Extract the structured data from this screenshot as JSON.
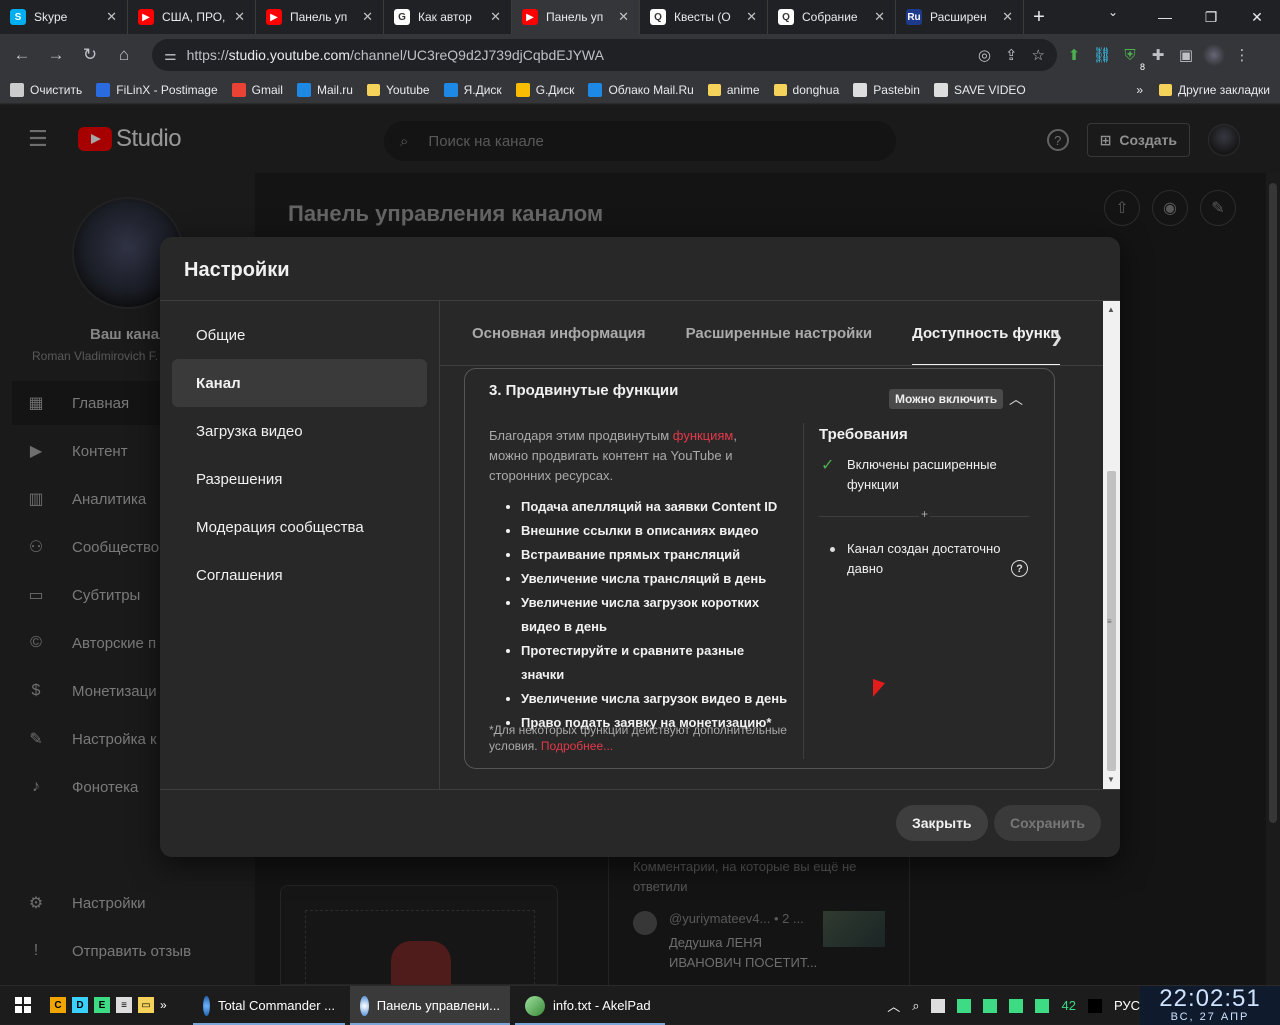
{
  "browser": {
    "tabs": [
      {
        "title": "Skype",
        "icon": "skype-icon",
        "color": "#00aff0",
        "glyph": "S",
        "active": false
      },
      {
        "title": "США, ПРО,",
        "icon": "youtube-icon",
        "color": "#ff0000",
        "glyph": "▶",
        "active": false
      },
      {
        "title": "Панель уп",
        "icon": "youtube-icon",
        "color": "#ff0000",
        "glyph": "▶",
        "active": false
      },
      {
        "title": "Как автор",
        "icon": "google-icon",
        "color": "#ffffff",
        "glyph": "G",
        "active": false
      },
      {
        "title": "Панель уп",
        "icon": "youtube-icon",
        "color": "#ff0000",
        "glyph": "▶",
        "active": true
      },
      {
        "title": "Квесты (О",
        "icon": "quest-icon",
        "color": "#ffffff",
        "glyph": "Q",
        "active": false
      },
      {
        "title": "Собрание",
        "icon": "quest-icon",
        "color": "#ffffff",
        "glyph": "Q",
        "active": false
      },
      {
        "title": "Расширен",
        "icon": "ru-icon",
        "color": "#1e3a8a",
        "glyph": "Ru",
        "active": false
      }
    ],
    "url_prefix": "https://",
    "url_host": "studio.youtube.com",
    "url_path": "/channel/UC3reQ9d2J739djCqbdEJYWA",
    "extension_badge": "8",
    "bookmarks": [
      {
        "label": "Очистить",
        "icon": "gear-icon"
      },
      {
        "label": "FiLinX - Postimage",
        "icon": "postimage-icon"
      },
      {
        "label": "Gmail",
        "icon": "gmail-icon"
      },
      {
        "label": "Mail.ru",
        "icon": "mailru-icon"
      },
      {
        "label": "Youtube",
        "icon": "folder-icon"
      },
      {
        "label": "Я.Диск",
        "icon": "yadisk-icon"
      },
      {
        "label": "G.Диск",
        "icon": "gdrive-icon"
      },
      {
        "label": "Облако Mail.Ru",
        "icon": "cloud-icon"
      },
      {
        "label": "anime",
        "icon": "folder-icon"
      },
      {
        "label": "donghua",
        "icon": "folder-icon"
      },
      {
        "label": "Pastebin",
        "icon": "pastebin-icon"
      },
      {
        "label": "SAVE VIDEO",
        "icon": "savevideo-icon"
      }
    ],
    "bookmarks_more": "»",
    "other_bookmarks": "Другие закладки"
  },
  "studio": {
    "logo_text": "Studio",
    "search_placeholder": "Поиск на канале",
    "create_label": "Создать",
    "page_title": "Панель управления каналом",
    "channel_label": "Ваш канал",
    "channel_name": "Roman Vladimirovich F.",
    "nav": [
      {
        "label": "Главная",
        "icon": "dashboard-icon",
        "glyph": "▦"
      },
      {
        "label": "Контент",
        "icon": "content-icon",
        "glyph": "▶"
      },
      {
        "label": "Аналитика",
        "icon": "analytics-icon",
        "glyph": "▥"
      },
      {
        "label": "Сообщество",
        "icon": "community-icon",
        "glyph": "⚇"
      },
      {
        "label": "Субтитры",
        "icon": "subtitles-icon",
        "glyph": "▭"
      },
      {
        "label": "Авторские п",
        "icon": "copyright-icon",
        "glyph": "©"
      },
      {
        "label": "Монетизаци",
        "icon": "dollar-icon",
        "glyph": "$"
      },
      {
        "label": "Настройка к",
        "icon": "magic-wand-icon",
        "glyph": "✎"
      },
      {
        "label": "Фонотека",
        "icon": "music-icon",
        "glyph": "♪"
      }
    ],
    "bottom_nav": [
      {
        "label": "Настройки",
        "icon": "gear-icon",
        "glyph": "⚙"
      },
      {
        "label": "Отправить отзыв",
        "icon": "feedback-icon",
        "glyph": "!"
      }
    ],
    "comments_heading": "Комментарии, на которые вы ещё не ответили",
    "comment_author": "@yuriymateev4... • 2 ...",
    "comment_text": "Дедушка ЛЕНЯ ИВАНОВИЧ ПОСЕТИТ..."
  },
  "dialog": {
    "title": "Настройки",
    "nav": [
      "Общие",
      "Канал",
      "Загрузка видео",
      "Разрешения",
      "Модерация сообщества",
      "Соглашения"
    ],
    "active_nav": 1,
    "tabs": [
      "Основная информация",
      "Расширенные настройки",
      "Доступность функц"
    ],
    "active_tab": 2,
    "section_title": "3. Продвинутые функции",
    "section_badge": "Можно включить",
    "desc_before": "Благодаря этим продвинутым ",
    "desc_link": "функциям",
    "desc_after": ", можно продвигать контент на YouTube и сторонних ресурсах.",
    "features": [
      "Подача апелляций на заявки Content ID",
      "Внешние ссылки в описаниях видео",
      "Встраивание прямых трансляций",
      "Увеличение числа трансляций в день",
      "Увеличение числа загрузок коротких видео в день",
      "Протестируйте и сравните разные значки",
      "Увеличение числа загрузок видео в день",
      "Право подать заявку на монетизацию*"
    ],
    "note_text": "*Для некоторых функций действуют дополнительные условия. ",
    "note_link": "Подробнее...",
    "requirements_title": "Требования",
    "requirement_met": "Включены расширенные функции",
    "separator_plus": "+",
    "requirement_pending": "Канал создан достаточно давно",
    "close_label": "Закрыть",
    "save_label": "Сохранить"
  },
  "taskbar": {
    "quick": [
      {
        "glyph": "C",
        "color": "#f0a500"
      },
      {
        "glyph": "D",
        "color": "#3ad1ff"
      },
      {
        "glyph": "E",
        "color": "#3ddc84"
      },
      {
        "glyph": "≡",
        "color": "#dddddd"
      },
      {
        "glyph": "▭",
        "color": "#f5d35a"
      }
    ],
    "quick_more": "»",
    "tasks": [
      {
        "label": "Total Commander ...",
        "icon": "total-commander-icon",
        "active": false
      },
      {
        "label": "Панель управлени...",
        "icon": "chrome-icon",
        "active": true
      },
      {
        "label": "info.txt - AkelPad",
        "icon": "akelpad-icon",
        "active": false
      }
    ],
    "tray_number": "42",
    "language": "РУС",
    "time": "22:02:51",
    "date": "ВС, 27   АПР"
  }
}
